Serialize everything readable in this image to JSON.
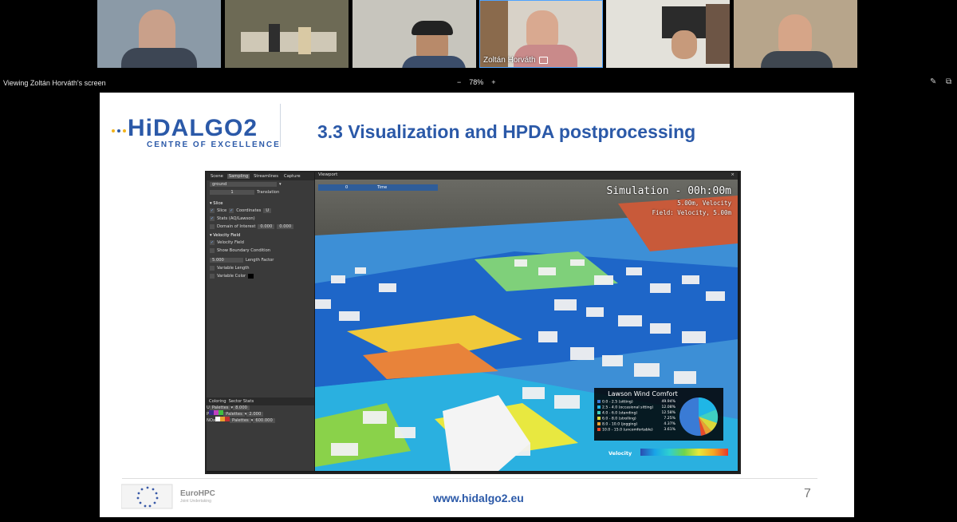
{
  "participants": [
    {
      "id": "p1",
      "name": "",
      "bg": "#8b9aa7"
    },
    {
      "id": "p2",
      "name": "",
      "bg": "#6d6a55"
    },
    {
      "id": "p3",
      "name": "",
      "bg": "#c7c5bd"
    },
    {
      "id": "p4",
      "name": "Zoltán Horváth",
      "bg": "#d8d2c8"
    },
    {
      "id": "p5",
      "name": "",
      "bg": "#e3e1da"
    },
    {
      "id": "p6",
      "name": "",
      "bg": "#b7a58b"
    }
  ],
  "topbar": {
    "viewing": "Viewing Zoltán Horváth's screen",
    "zoom_minus": "−",
    "zoom_value": "78%",
    "zoom_plus": "+",
    "icons": [
      "annotate-icon",
      "popout-icon"
    ]
  },
  "slide": {
    "logo_main": "HiDALGO2",
    "logo_sub": "CENTRE OF EXCELLENCE",
    "title": "3.3 Visualization and HPDA postprocessing",
    "url": "www.hidalgo2.eu",
    "page_number": "7",
    "eurohpc": "EuroHPC",
    "eurohpc_sub": "Joint Undertaking"
  },
  "app": {
    "tabs": [
      "Scene",
      "Sampling",
      "Streamlines",
      "Capture"
    ],
    "active_tab": "Sampling",
    "dropdown": "ground",
    "translation_value": "1",
    "translation_label": "Translation",
    "slice_section": "Slice",
    "slice_label": "Slice",
    "coordinates_label": "Coordinates",
    "coordinates_value": "U",
    "stats_label": "Stats (AQ/Lawson)",
    "doi_label": "Domain of Interest",
    "doi_v1": "0.000",
    "doi_v2": "0.000",
    "vf_section": "Velocity Field",
    "vf_label": "Velocity Field",
    "boundary_label": "Show Boundary Condition",
    "length_value": "5.000",
    "length_label": "Length Factor",
    "varlen_label": "Variable Length",
    "varcolor_label": "Variable Color",
    "coloring_tabs": [
      "Coloring",
      "Sector Stats"
    ],
    "palette_rows": [
      {
        "prefix": "U",
        "label": "Palettes",
        "value": "8.000"
      },
      {
        "prefix": "P",
        "label": "Palettes",
        "value": "2.000"
      },
      {
        "prefix": "NOx",
        "label": "Palettes",
        "value": "600.000"
      }
    ],
    "viewport_label": "Viewport",
    "time_value": "0",
    "time_label": "Time",
    "sim_title": "Simulation - 00h:00m",
    "sim_sub1": "5.00m, Velocity",
    "sim_sub2": "Field: Velocity, 5.00m",
    "lawson_title": "Lawson Wind Comfort",
    "lawson_rows": [
      {
        "label": "0.0 - 2.5 (sitting)",
        "pct": "49.94%",
        "color": "#3a7bd5"
      },
      {
        "label": "2.5 - 4.0 (occasional sitting)",
        "pct": "12.08%",
        "color": "#1fb6e6"
      },
      {
        "label": "4.0 - 6.0 (standing)",
        "pct": "12.58%",
        "color": "#3fd0c0"
      },
      {
        "label": "6.0 - 8.0 (strolling)",
        "pct": "7.25%",
        "color": "#d9d93a"
      },
      {
        "label": "8.0 - 10.0 (jogging)",
        "pct": "4.37%",
        "color": "#e8a030"
      },
      {
        "label": "10.0 - 15.0 (uncomfortable)",
        "pct": "3.61%",
        "color": "#e84a2a"
      }
    ],
    "velocity_label": "Velocity"
  }
}
